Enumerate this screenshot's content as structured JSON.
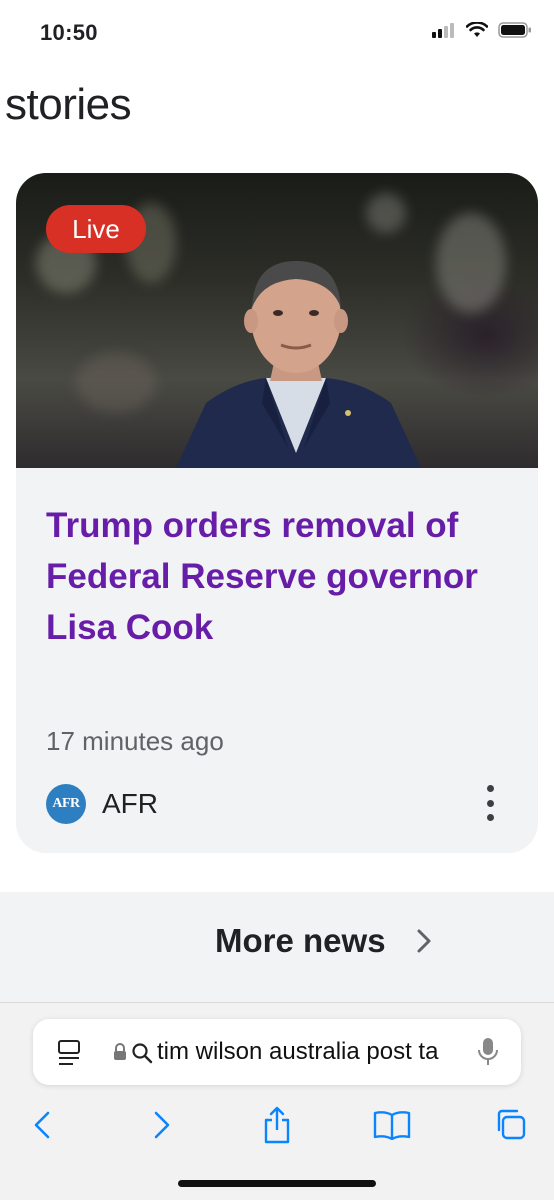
{
  "status_bar": {
    "time": "10:50"
  },
  "section": {
    "title": "stories"
  },
  "story": {
    "badge": "Live",
    "headline": "Trump orders removal of Federal Reserve governor Lisa Cook",
    "time_ago": "17 minutes ago",
    "source_name": "AFR",
    "source_logo_text": "AFR"
  },
  "more_news": {
    "label": "More news"
  },
  "browser": {
    "url_text": "tim wilson australia post ta",
    "toolbar": [
      "back",
      "forward",
      "share",
      "bookmarks",
      "tabs"
    ]
  },
  "colors": {
    "headline": "#681da8",
    "live_badge": "#d93025",
    "card_bg": "#f1f3f4",
    "browser_blue": "#0a84ff"
  }
}
